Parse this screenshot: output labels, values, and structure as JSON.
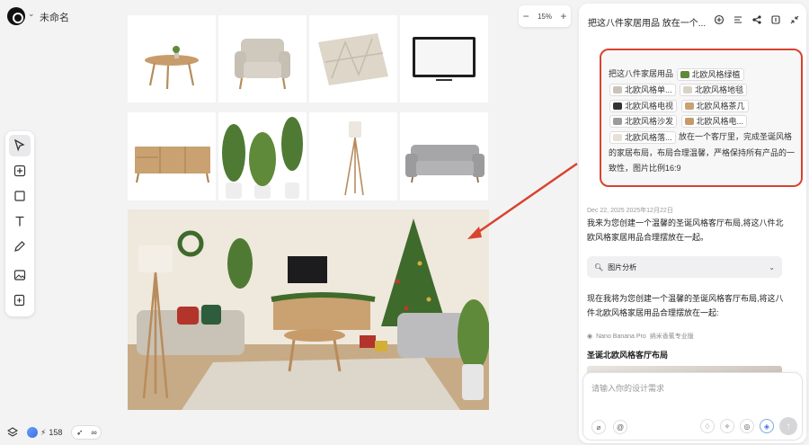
{
  "header": {
    "doc_title": "未命名",
    "zoom": "15%"
  },
  "toolbar": {
    "tools": [
      "select-icon",
      "add-frame-icon",
      "rectangle-icon",
      "text-icon",
      "pen-icon",
      "image-edit-icon",
      "image-add-icon"
    ]
  },
  "bottom": {
    "credits": "158"
  },
  "panel": {
    "title": "把这八件家居用品 放在一个...",
    "prompt": {
      "lead": "把这八件家居用品",
      "chips": [
        {
          "label": "北欧风格绿植",
          "color": "#5f8a3a"
        },
        {
          "label": "北欧风格单...",
          "color": "#c9c2b6"
        },
        {
          "label": "北欧风格地毯",
          "color": "#d8d2c6"
        },
        {
          "label": "北欧风格电视",
          "color": "#333333"
        },
        {
          "label": "北欧风格茶几",
          "color": "#c8a275"
        },
        {
          "label": "北欧风格沙发",
          "color": "#9b9b9b"
        },
        {
          "label": "北欧风格电...",
          "color": "#c49a68"
        },
        {
          "label": "北欧风格落...",
          "color": "#e6e0d6"
        }
      ],
      "tail": "放在一个客厅里，完成圣诞风格的家居布局，布局合理温馨，严格保持所有产品的一致性，图片比例16:9"
    },
    "date": "Dec 22, 2025  2025年12月22日",
    "reply1": "我来为您创建一个温馨的圣诞风格客厅布局,将这八件北欧风格家居用品合理摆放在一起。",
    "analysis_label": "图片分析",
    "reply2": "现在我将为您创建一个温馨的圣诞风格客厅布局,将这八件北欧风格家居用品合理摆放在一起:",
    "model": "Nano Banana Pro",
    "model_sub": "纳米香蕉专业版",
    "section_title": "圣诞北欧风格客厅布局",
    "input_placeholder": "请输入你的设计需求"
  },
  "colors": {
    "highlight": "#d9432f",
    "accent": "#3b6fe0"
  }
}
